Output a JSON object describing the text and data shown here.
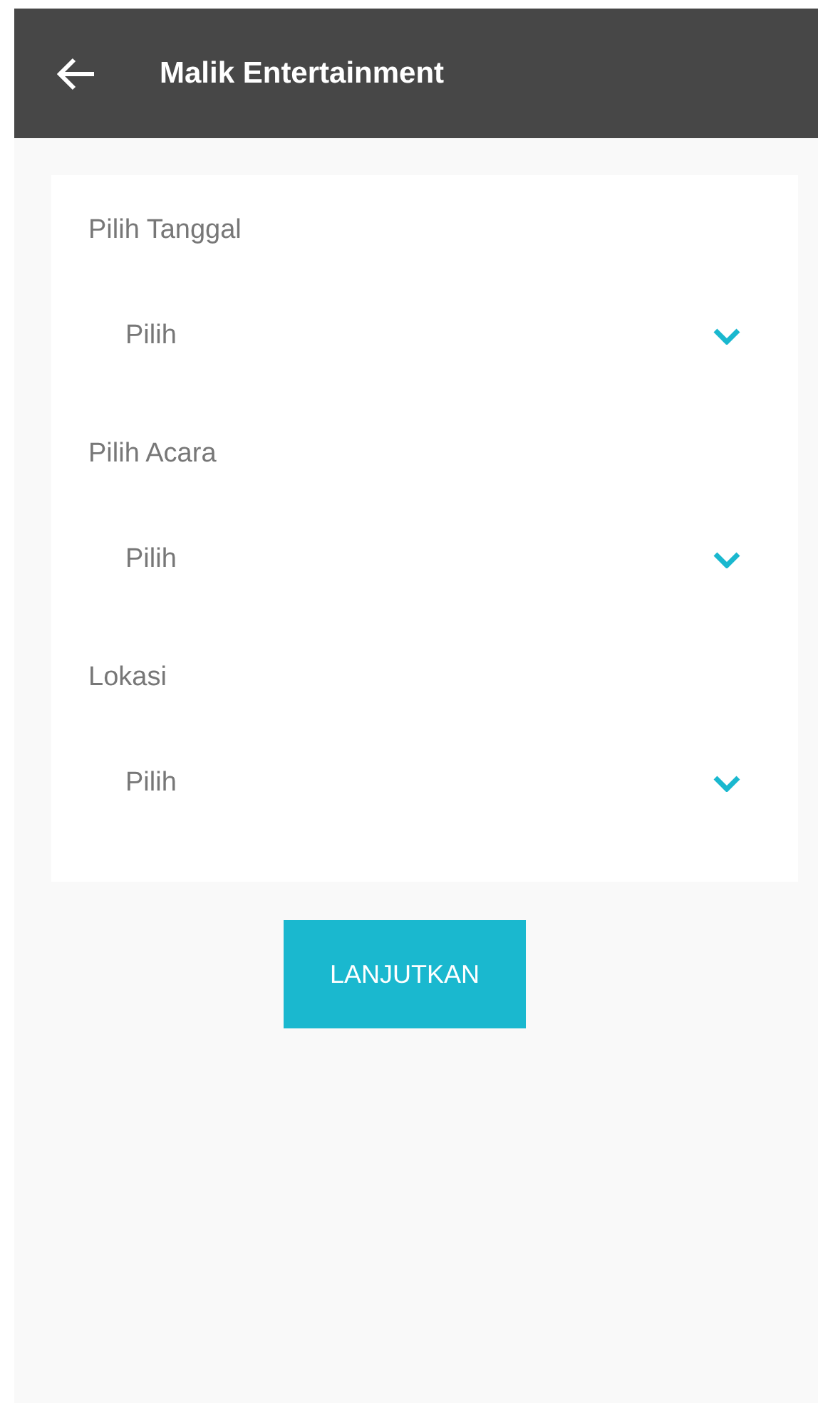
{
  "header": {
    "title": "Malik Entertainment"
  },
  "fields": [
    {
      "label": "Pilih Tanggal",
      "value": "Pilih"
    },
    {
      "label": "Pilih Acara",
      "value": "Pilih"
    },
    {
      "label": "Lokasi",
      "value": "Pilih"
    }
  ],
  "button": {
    "label": "LANJUTKAN"
  }
}
